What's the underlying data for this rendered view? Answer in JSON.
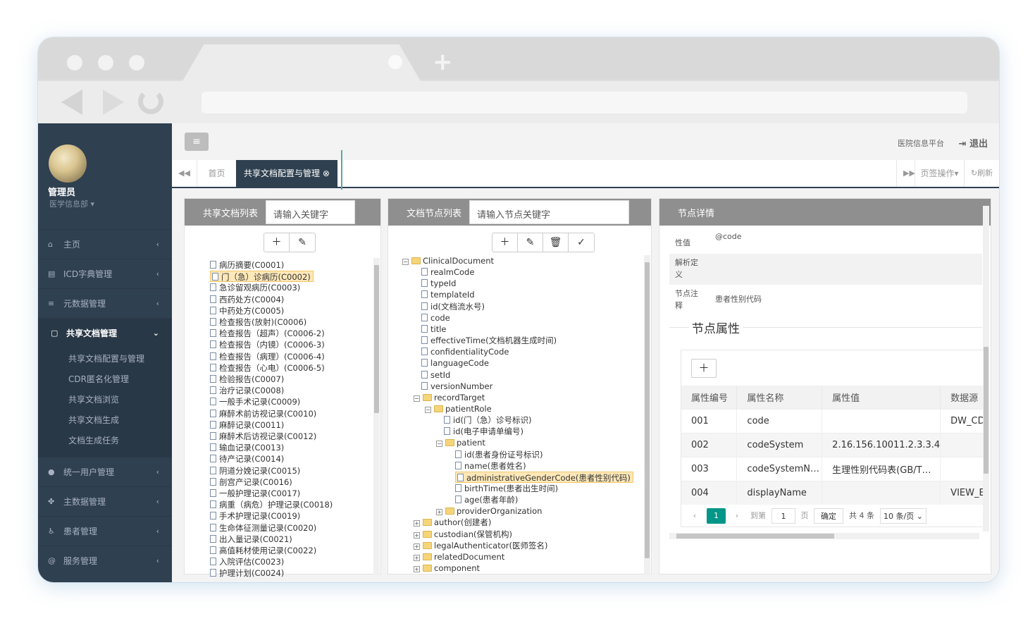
{
  "sidebar": {
    "user_name": "管理员",
    "user_dept": "医学信息部",
    "menu": [
      {
        "label": "主页",
        "icon": "home-icon",
        "glyph": "⌂"
      },
      {
        "label": "ICD字典管理",
        "icon": "book-icon",
        "glyph": "▤"
      },
      {
        "label": "元数据管理",
        "icon": "database-icon",
        "glyph": "≡"
      },
      {
        "label": "共享文档管理",
        "icon": "file-icon",
        "glyph": "▢"
      },
      {
        "label": "统一用户管理",
        "icon": "user-icon",
        "glyph": "●"
      },
      {
        "label": "主数据管理",
        "icon": "users-icon",
        "glyph": "✤"
      },
      {
        "label": "患者管理",
        "icon": "wheelchair-icon",
        "glyph": "♿"
      },
      {
        "label": "服务管理",
        "icon": "at-icon",
        "glyph": "@"
      }
    ],
    "submenu": [
      "共享文档配置与管理",
      "CDR匿名化管理",
      "共享文档浏览",
      "共享文档生成",
      "文档生成任务"
    ]
  },
  "topbar": {
    "platform": "医院信息平台",
    "logout": "退出"
  },
  "tabs": {
    "home": "首页",
    "active": "共享文档配置与管理",
    "page_ops": "页签操作",
    "refresh": "刷新"
  },
  "doc_list": {
    "title": "共享文档列表",
    "search_placeholder": "请输入关键字",
    "items": [
      "病历摘要(C0001)",
      "门（急）诊病历(C0002)",
      "急诊留观病历(C0003)",
      "西药处方(C0004)",
      "中药处方(C0005)",
      "检查报告(放射)(C0006)",
      "检查报告（超声）(C0006-2)",
      "检查报告（内镜）(C0006-3)",
      "检查报告（病理）(C0006-4)",
      "检查报告（心电）(C0006-5)",
      "检验报告(C0007)",
      "治疗记录(C0008)",
      "一般手术记录(C0009)",
      "麻醉术前访视记录(C0010)",
      "麻醉记录(C0011)",
      "麻醉术后访视记录(C0012)",
      "输血记录(C0013)",
      "待产记录(C0014)",
      "阴道分娩记录(C0015)",
      "剖宫产记录(C0016)",
      "一般护理记录(C0017)",
      "病重（病危）护理记录(C0018)",
      "手术护理记录(C0019)",
      "生命体征测量记录(C0020)",
      "出入量记录(C0021)",
      "高值耗材使用记录(C0022)",
      "入院评估(C0023)",
      "护理计划(C0024)"
    ]
  },
  "node_list": {
    "title": "文档节点列表",
    "search_placeholder": "请输入节点关键字",
    "nodes": [
      {
        "label": "ClinicalDocument",
        "type": "folder",
        "exp": "⊟",
        "level": 0
      },
      {
        "label": "realmCode",
        "type": "doc",
        "level": 1
      },
      {
        "label": "typeId",
        "type": "doc",
        "level": 1
      },
      {
        "label": "templateId",
        "type": "doc",
        "level": 1
      },
      {
        "label": "id(文档流水号)",
        "type": "doc",
        "level": 1
      },
      {
        "label": "code",
        "type": "doc",
        "level": 1
      },
      {
        "label": "title",
        "type": "doc",
        "level": 1
      },
      {
        "label": "effectiveTime(文档机器生成时间)",
        "type": "doc",
        "level": 1
      },
      {
        "label": "confidentialityCode",
        "type": "doc",
        "level": 1
      },
      {
        "label": "languageCode",
        "type": "doc",
        "level": 1
      },
      {
        "label": "setId",
        "type": "doc",
        "level": 1
      },
      {
        "label": "versionNumber",
        "type": "doc",
        "level": 1
      },
      {
        "label": "recordTarget",
        "type": "folder",
        "exp": "⊟",
        "level": 1
      },
      {
        "label": "patientRole",
        "type": "folder",
        "exp": "⊟",
        "level": 2
      },
      {
        "label": "id(门（急）诊号标识)",
        "type": "doc",
        "level": 3
      },
      {
        "label": "id(电子申请单编号)",
        "type": "doc",
        "level": 3
      },
      {
        "label": "patient",
        "type": "folder",
        "exp": "⊟",
        "level": 3
      },
      {
        "label": "id(患者身份证号标识)",
        "type": "doc",
        "level": 4
      },
      {
        "label": "name(患者姓名)",
        "type": "doc",
        "level": 4
      },
      {
        "label": "administrativeGenderCode(患者性别代码)",
        "type": "doc",
        "level": 4,
        "sel": true
      },
      {
        "label": "birthTime(患者出生时间)",
        "type": "doc",
        "level": 4
      },
      {
        "label": "age(患者年龄)",
        "type": "doc",
        "level": 4
      },
      {
        "label": "providerOrganization",
        "type": "folder",
        "exp": "⊞",
        "level": 3
      },
      {
        "label": "author(创建者)",
        "type": "folder",
        "exp": "⊞",
        "level": 1
      },
      {
        "label": "custodian(保管机构)",
        "type": "folder",
        "exp": "⊞",
        "level": 1
      },
      {
        "label": "legalAuthenticator(医师签名)",
        "type": "folder",
        "exp": "⊞",
        "level": 1
      },
      {
        "label": "relatedDocument",
        "type": "folder",
        "exp": "⊞",
        "level": 1
      },
      {
        "label": "component",
        "type": "folder",
        "exp": "⊞",
        "level": 1
      }
    ]
  },
  "node_detail": {
    "title": "节点详情",
    "props": [
      {
        "label": "性值",
        "value": "@code"
      },
      {
        "label": "解析定义",
        "value": ""
      },
      {
        "label": "节点注释",
        "value": "患者性别代码"
      }
    ],
    "attr_title": "节点属性",
    "columns": [
      "属性编号",
      "属性名称",
      "属性值",
      "数据源"
    ],
    "rows": [
      [
        "001",
        "code",
        "",
        "DW_CDF"
      ],
      [
        "002",
        "codeSystem",
        "2.16.156.10011.2.3.3.4",
        ""
      ],
      [
        "003",
        "codeSystemN…",
        "生理性别代码表(GB/T…",
        ""
      ],
      [
        "004",
        "displayName",
        "",
        "VIEW_EI"
      ]
    ],
    "pager": {
      "current": "1",
      "goto": "到第",
      "goto_value": "1",
      "page_unit": "页",
      "confirm": "确定",
      "total": "共 4 条",
      "page_size": "10 条/页"
    }
  }
}
